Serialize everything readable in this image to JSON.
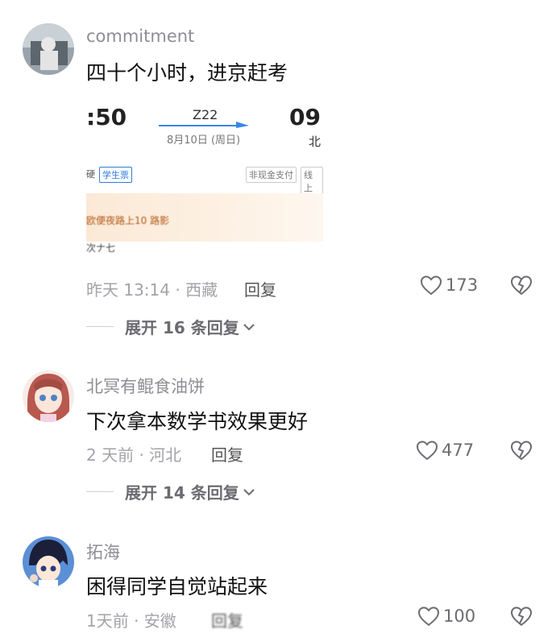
{
  "comments": [
    {
      "username": "commitment",
      "content": "四十个小时，进京赶考",
      "meta": "昨天 13:14 · 西藏",
      "reply": "回复",
      "likes": "173",
      "expand": "展开 16 条回复"
    },
    {
      "username": "北冥有鲲食油饼",
      "content": "下次拿本数学书效果更好",
      "meta": "2 天前 · 河北",
      "reply": "回复",
      "likes": "477",
      "expand": "展开 14 条回复"
    },
    {
      "username": "拓海",
      "content": "困得同学自觉站起来",
      "meta": "1天前 · 安徽",
      "reply": "回复",
      "likes": "100"
    }
  ],
  "ticket": {
    "depart_time": ":50",
    "arrive_time": "09:",
    "train": "Z22",
    "date": "8月10日 (周日)",
    "arrive_city": "北",
    "seat_tag": "硬",
    "student_tag": "学生票",
    "pay_tag": "非现金支付",
    "online_tag": "线上",
    "banner_text": "欧便夜路上10 路影",
    "bottom_text": "次ナ七"
  },
  "colors": {
    "username": "#8e8e93",
    "content": "#111111",
    "meta": "#a3a3a8",
    "accent_blue": "#2d7be0"
  },
  "icons": [
    "heart-outline-icon",
    "broken-heart-icon",
    "chevron-down-icon"
  ]
}
